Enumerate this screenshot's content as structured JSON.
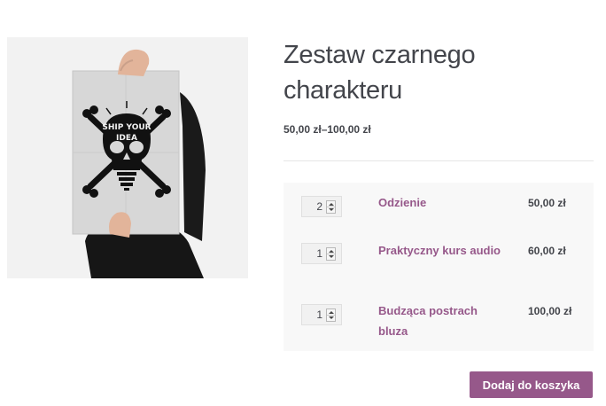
{
  "product": {
    "title": "Zestaw czarnego charakteru",
    "price_range": "50,00 zł–100,00 zł",
    "image_icon": "poster-skull-image",
    "poster_text_line1": "SHIP YOUR",
    "poster_text_line2": "IDEA"
  },
  "grouped_items": [
    {
      "quantity": "2",
      "name": "Odzienie",
      "price": "50,00 zł"
    },
    {
      "quantity": "1",
      "name": "Praktyczny kurs audio",
      "price": "60,00 zł"
    },
    {
      "quantity": "1",
      "name": "Budząca postrach bluza",
      "price": "100,00 zł"
    }
  ],
  "actions": {
    "add_to_cart_label": "Dodaj do koszyka"
  },
  "colors": {
    "accent": "#96588a",
    "text": "#43454b",
    "table_bg": "#f8f8f8"
  }
}
